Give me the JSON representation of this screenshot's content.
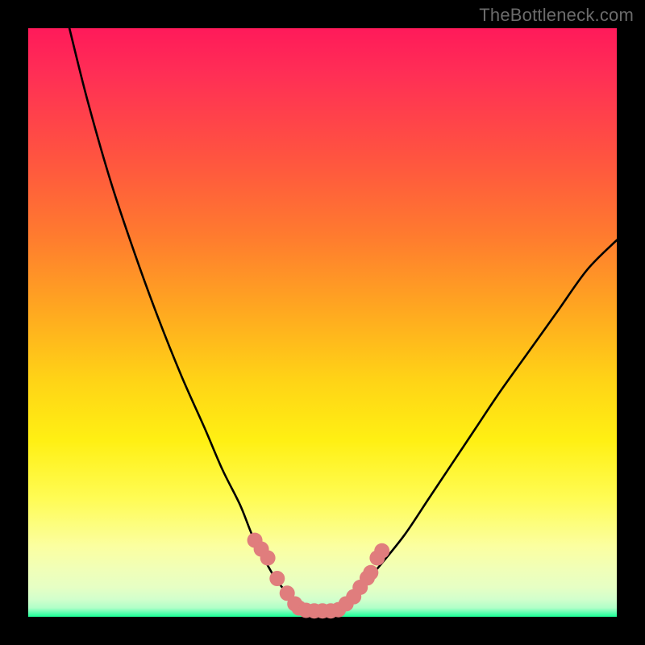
{
  "watermark": "TheBottleneck.com",
  "colors": {
    "frame": "#000000",
    "curve": "#000000",
    "marker": "#e07d7d"
  },
  "chart_data": {
    "type": "line",
    "title": "",
    "xlabel": "",
    "ylabel": "",
    "xlim": [
      0,
      100
    ],
    "ylim": [
      0,
      100
    ],
    "grid": false,
    "legend": false,
    "note": "Axis values estimated from pixel positions; no numeric tick labels are visible in the image.",
    "series": [
      {
        "name": "left-curve",
        "x": [
          7,
          10,
          14,
          18,
          22,
          26,
          30,
          33,
          36,
          38,
          40,
          42,
          44,
          45.5,
          46.5
        ],
        "y": [
          100,
          88,
          74,
          62,
          51,
          41,
          32,
          25,
          19,
          14,
          10,
          6.5,
          4,
          2.2,
          1.4
        ]
      },
      {
        "name": "valley-floor",
        "x": [
          46.5,
          47.5,
          49,
          50.5,
          52,
          53
        ],
        "y": [
          1.4,
          1.1,
          1.0,
          1.0,
          1.1,
          1.4
        ]
      },
      {
        "name": "right-curve",
        "x": [
          53,
          55,
          57,
          60,
          64,
          68,
          72,
          76,
          80,
          85,
          90,
          95,
          100
        ],
        "y": [
          1.4,
          3,
          5.5,
          9,
          14,
          20,
          26,
          32,
          38,
          45,
          52,
          59,
          64
        ]
      }
    ],
    "markers": {
      "name": "data-points",
      "x": [
        38.5,
        39.6,
        40.7,
        42.3,
        44.0,
        45.3,
        46.0,
        47.2,
        48.6,
        50.0,
        51.4,
        52.7,
        54.0,
        55.3,
        56.4,
        57.6,
        58.2,
        59.3,
        60.1
      ],
      "y": [
        13.0,
        11.5,
        10.0,
        6.5,
        4.0,
        2.2,
        1.5,
        1.1,
        1.0,
        1.0,
        1.0,
        1.2,
        2.2,
        3.4,
        5.0,
        6.6,
        7.5,
        10.0,
        11.2
      ],
      "radius": 1.3
    }
  }
}
